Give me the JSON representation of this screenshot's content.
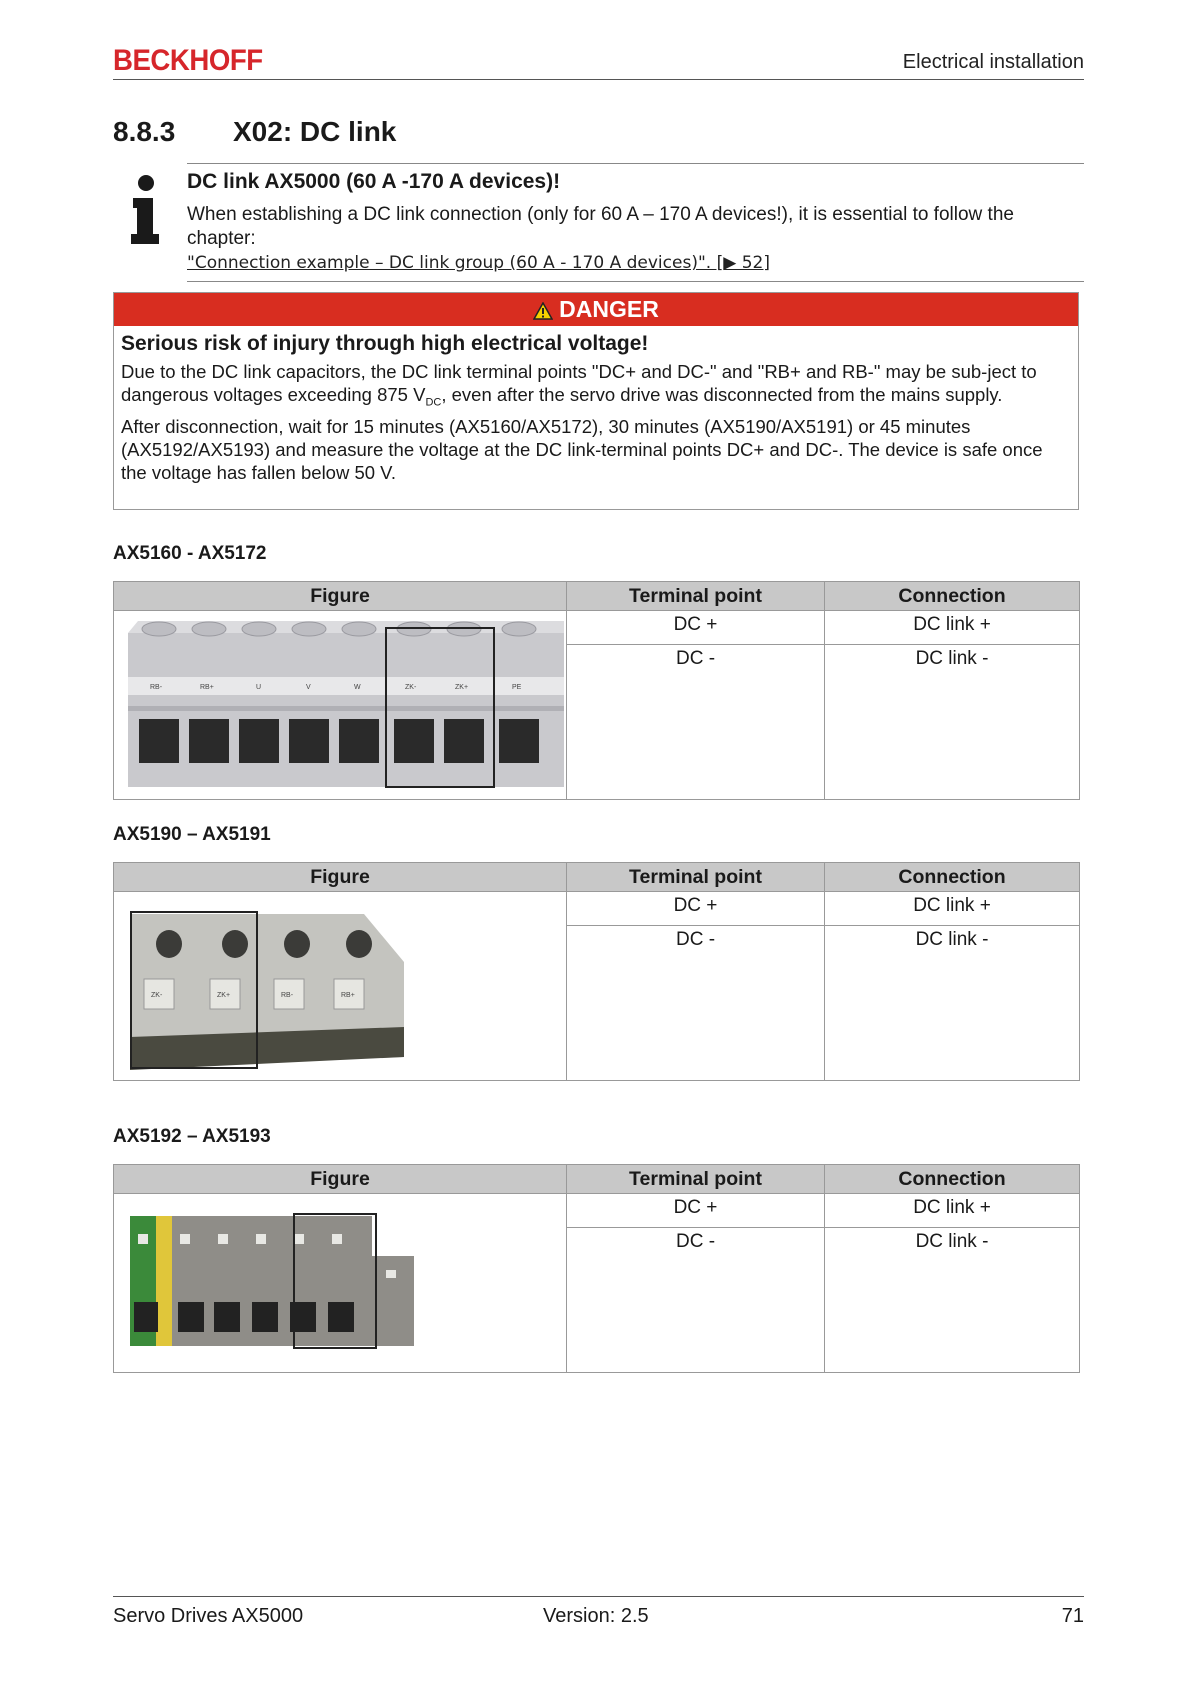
{
  "header": {
    "logo": "BECKHOFF",
    "section": "Electrical installation"
  },
  "section": {
    "number": "8.8.3",
    "title": "X02: DC link"
  },
  "note": {
    "title": "DC link AX5000 (60 A -170 A devices)!",
    "body": "When establishing a DC link connection (only for 60 A – 170 A devices!), it is essential to follow the chapter:",
    "link": "\"Connection example – DC link group (60 A - 170 A devices)\". [▶ 52]"
  },
  "danger": {
    "label": "DANGER",
    "title": "Serious risk of injury through high electrical voltage!",
    "body1_a": "Due to the DC link capacitors, the DC link terminal points \"DC+ and DC-\" and \"RB+ and RB-\" may be sub-ject to dangerous voltages exceeding 875 V",
    "body1_sub": "DC",
    "body1_b": ", even after the servo drive was disconnected from the mains supply.",
    "body2": "After disconnection, wait for 15 minutes (AX5160/AX5172), 30 minutes (AX5190/AX5191) or 45 minutes (AX5192/AX5193) and measure the voltage at the DC link-terminal points DC+ and DC-. The device is safe once the voltage has fallen below 50 V."
  },
  "table_headers": {
    "figure": "Figure",
    "terminal": "Terminal point",
    "connection": "Connection"
  },
  "tables": [
    {
      "heading": "AX5160 - AX5172",
      "labels": [
        "RB-",
        "RB+",
        "U",
        "V",
        "W",
        "ZK-",
        "ZK+",
        "PE"
      ],
      "rows": [
        {
          "terminal": "DC +",
          "connection": "DC link +"
        },
        {
          "terminal": "DC -",
          "connection": "DC link -"
        }
      ]
    },
    {
      "heading": "AX5190 – AX5191",
      "labels": [
        "ZK-",
        "ZK+",
        "RB-",
        "RB+"
      ],
      "rows": [
        {
          "terminal": "DC +",
          "connection": "DC link +"
        },
        {
          "terminal": "DC -",
          "connection": "DC link -"
        }
      ]
    },
    {
      "heading": "AX5192 – AX5193",
      "rows": [
        {
          "terminal": "DC +",
          "connection": "DC link +"
        },
        {
          "terminal": "DC -",
          "connection": "DC link -"
        }
      ]
    }
  ],
  "footer": {
    "left": "Servo Drives AX5000",
    "middle": "Version: 2.5",
    "right": "71"
  }
}
